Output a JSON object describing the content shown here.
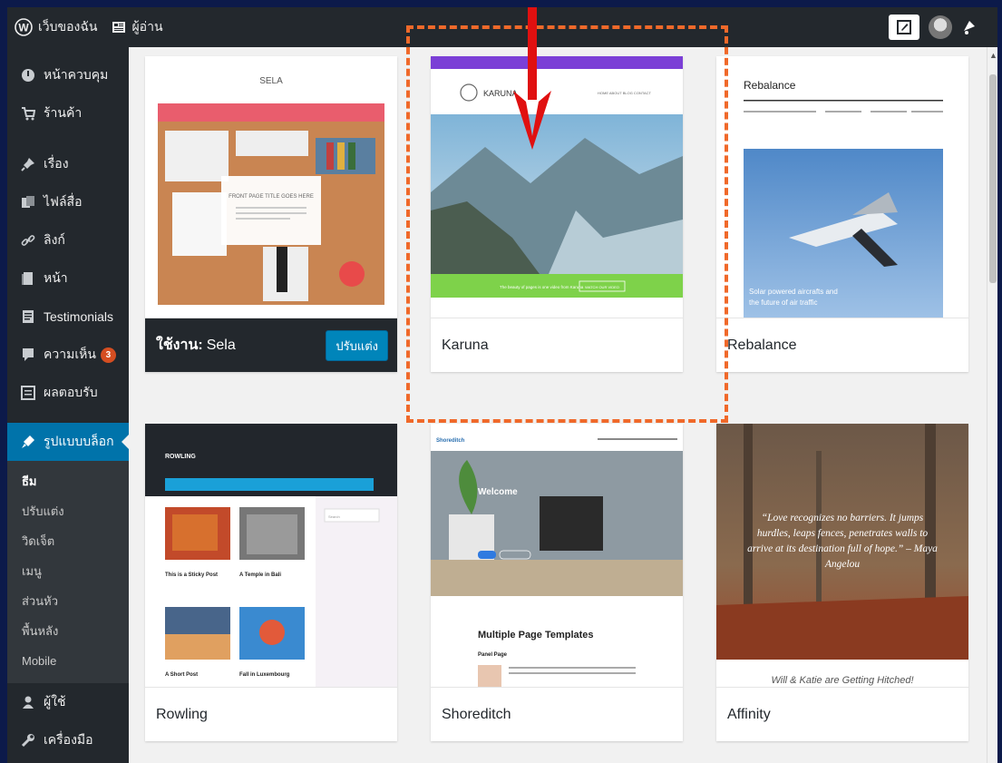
{
  "adminbar": {
    "site_name": "เว็บของฉัน",
    "reader": "ผู้อ่าน"
  },
  "sidebar": {
    "items": [
      {
        "label": "หน้าควบคุม",
        "icon": "dashboard-icon"
      },
      {
        "label": "ร้านค้า",
        "icon": "cart-icon"
      },
      {
        "label": "เรื่อง",
        "icon": "pin-icon"
      },
      {
        "label": "ไฟล์สื่อ",
        "icon": "media-icon"
      },
      {
        "label": "ลิงก์",
        "icon": "link-icon"
      },
      {
        "label": "หน้า",
        "icon": "page-icon"
      },
      {
        "label": "Testimonials",
        "icon": "testimonial-icon"
      },
      {
        "label": "ความเห็น",
        "icon": "comment-icon",
        "badge": "3"
      },
      {
        "label": "ผลตอบรับ",
        "icon": "feedback-icon"
      },
      {
        "label": "รูปแบบบล็อก",
        "icon": "appearance-icon"
      }
    ],
    "submenu": [
      "ธีม",
      "ปรับแต่ง",
      "วิดเจ็ต",
      "เมนู",
      "ส่วนหัว",
      "พื้นหลัง",
      "Mobile"
    ],
    "bottom_items": [
      {
        "label": "ผู้ใช้",
        "icon": "users-icon"
      },
      {
        "label": "เครื่องมือ",
        "icon": "tools-icon"
      }
    ]
  },
  "themes": {
    "active_prefix": "ใช้งาน:",
    "active_name": "Sela",
    "customize_label": "ปรับแต่ง",
    "cards": [
      {
        "name": "Karuna"
      },
      {
        "name": "Rebalance"
      },
      {
        "name": "Rowling"
      },
      {
        "name": "Shoreditch"
      },
      {
        "name": "Affinity"
      }
    ]
  },
  "previews": {
    "sela": {
      "title": "SELA",
      "front_title": "FRONT PAGE TITLE GOES HERE"
    },
    "karuna": {
      "brand": "KARUNA",
      "nav": "HOME  ABOUT  BLOG  CONTACT",
      "banner": "The beauty of pages is one video from Karuna",
      "banner_button": "WATCH OUR VIDEO"
    },
    "rebalance": {
      "title": "Rebalance",
      "caption": "Solar powered aircrafts and the future of air traffic"
    },
    "rowling": {
      "title": "ROWLING",
      "post1": "This is a Sticky Post",
      "post2": "A Temple in Bali",
      "post3": "A Short Post",
      "post4": "Fall in Luxembourg",
      "search": "Search"
    },
    "shoreditch": {
      "brand": "Shoreditch",
      "welcome": "Welcome",
      "templates": "Multiple Page Templates",
      "panel": "Panel Page"
    },
    "affinity": {
      "quote": "“Love recognizes no barriers. It jumps hurdles, leaps fences, penetrates walls to arrive at its destination full of hope.” – Maya Angelou",
      "footer_text": "Will & Katie are Getting Hitched!"
    }
  },
  "colors": {
    "adminbar": "#23282d",
    "accent": "#0073aa",
    "highlight": "#f0692a",
    "arrow": "#e01010"
  }
}
